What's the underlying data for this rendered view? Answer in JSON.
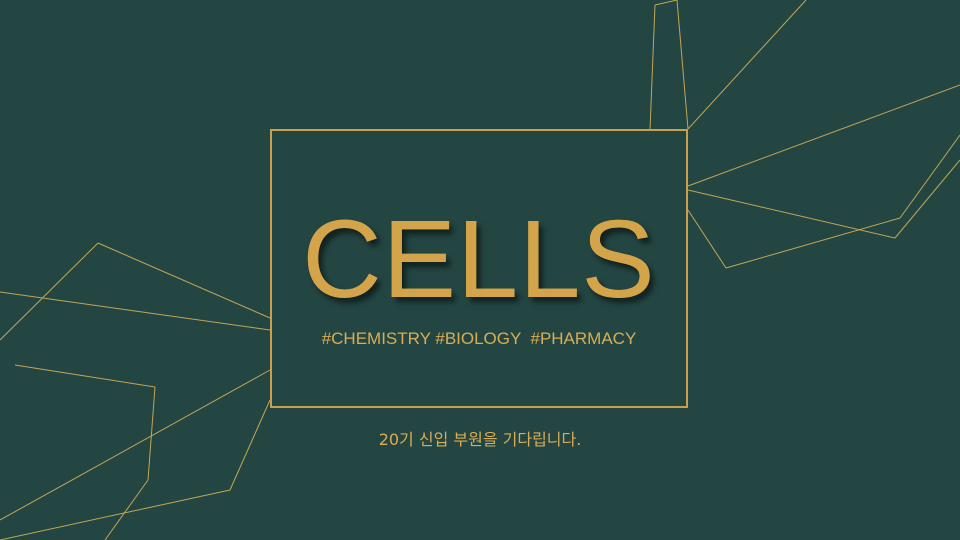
{
  "slide": {
    "title": "CELLS",
    "tags": "#CHEMISTRY #BIOLOGY  #PHARMACY",
    "subtitle": "20기 신입 부원을 기다립니다."
  },
  "colors": {
    "background": "#244643",
    "gold": "#c9a04c",
    "line": "#c2a655"
  }
}
